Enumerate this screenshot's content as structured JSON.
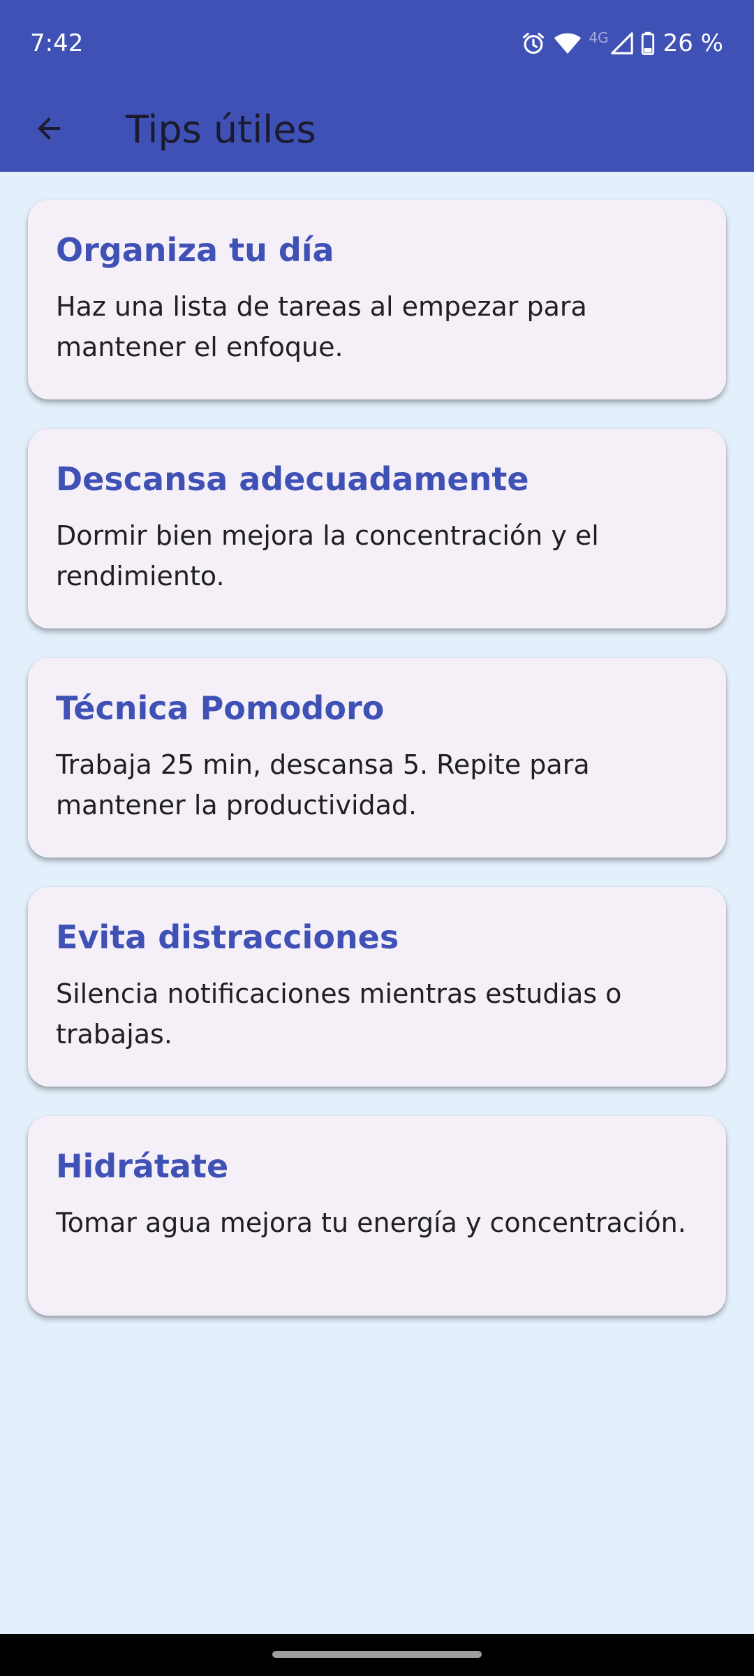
{
  "status_bar": {
    "time": "7:42",
    "network_label": "4G",
    "battery_percent": "26 %",
    "icons": [
      "alarm-icon",
      "wifi-icon",
      "signal-icon",
      "battery-icon"
    ]
  },
  "app_bar": {
    "title": "Tips útiles",
    "back_icon": "arrow-back-icon"
  },
  "colors": {
    "primary": "#3F51B5",
    "background": "#E3EFFB",
    "card_background": "#F5F0F8",
    "title_text": "#3F51B5",
    "body_text": "#1F1F1F"
  },
  "tips": [
    {
      "title": "Organiza tu día",
      "text": "Haz una lista de tareas al empezar para mantener el enfoque."
    },
    {
      "title": "Descansa adecuadamente",
      "text": "Dormir bien mejora la concentración y el rendimiento."
    },
    {
      "title": "Técnica Pomodoro",
      "text": "Trabaja 25 min, descansa 5. Repite para mantener la productividad."
    },
    {
      "title": "Evita distracciones",
      "text": "Silencia notificaciones mientras estudias o trabajas."
    },
    {
      "title": "Hidrátate",
      "text": "Tomar agua mejora tu energía y concentración."
    }
  ]
}
